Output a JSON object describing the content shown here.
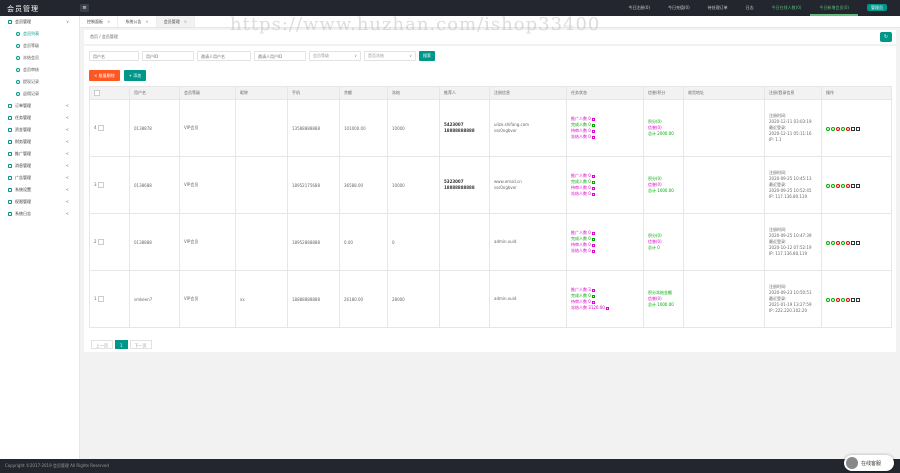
{
  "app": {
    "title": "会员管理"
  },
  "topnav": [
    {
      "label": "今日注册(0)",
      "style": "n"
    },
    {
      "label": "今日充值(0)",
      "style": "n"
    },
    {
      "label": "待处理订单",
      "style": "n"
    },
    {
      "label": "日志",
      "style": "n"
    },
    {
      "label": "今日在线人数(0)",
      "style": "n hl"
    },
    {
      "label": "今日新增会员(0)",
      "style": "n hl act"
    },
    {
      "label": "管理员",
      "style": "n pill"
    }
  ],
  "sidebar": [
    {
      "label": "会员管理",
      "sub": false,
      "chev": "∨"
    },
    {
      "label": "会员列表",
      "sub": true
    },
    {
      "label": "会员等级",
      "sub": true
    },
    {
      "label": "冻结会员",
      "sub": true
    },
    {
      "label": "会员审核",
      "sub": true
    },
    {
      "label": "提现记录",
      "sub": true
    },
    {
      "label": "返佣记录",
      "sub": true
    },
    {
      "label": "订单管理",
      "sub": false,
      "chev": "<"
    },
    {
      "label": "任务管理",
      "sub": false,
      "chev": "<"
    },
    {
      "label": "资金管理",
      "sub": false,
      "chev": "<"
    },
    {
      "label": "财务管理",
      "sub": false,
      "chev": "<"
    },
    {
      "label": "推广管理",
      "sub": false,
      "chev": "<"
    },
    {
      "label": "消息管理",
      "sub": false,
      "chev": "<"
    },
    {
      "label": "广告管理",
      "sub": false,
      "chev": "<"
    },
    {
      "label": "系统设置",
      "sub": false,
      "chev": "<"
    },
    {
      "label": "权限管理",
      "sub": false,
      "chev": "<"
    },
    {
      "label": "系统日志",
      "sub": false,
      "chev": "<"
    }
  ],
  "tabs": [
    {
      "label": "控制面板",
      "close": "×"
    },
    {
      "label": "系统公告",
      "close": "×"
    },
    {
      "label": "会员管理",
      "close": "×"
    }
  ],
  "breadcrumb": "首页 / 会员管理",
  "refresh_icon": "↻",
  "filters": {
    "f1": "用户名",
    "f2": "用户ID",
    "f3": "邀请人用户名",
    "f4": "邀请人用户ID",
    "f5": "会员等级",
    "f6": "是否冻结",
    "search": "搜索"
  },
  "buttons": {
    "delete": "× 批量删除",
    "add": "+ 添加"
  },
  "table": {
    "headers": [
      "",
      "用户名",
      "会员等级",
      "昵称",
      "手机",
      "余额",
      "冻结",
      "推荐人",
      "注册信息",
      "任务状态",
      "信誉/积分",
      "收货地址",
      "注册/登录信息",
      "操作"
    ],
    "rows": [
      {
        "id": "4",
        "username": "0138878",
        "level": "VIP会员",
        "nick": "",
        "phone": "13588888888",
        "balance": "101000.00",
        "frozen": "10000",
        "ref1": "5423007",
        "ref2": "18888888888",
        "reg1": "ulize.shifang.com",
        "reg2": "sss0ngbvor",
        "t1": "推广人数 0",
        "t2": "完成人数 0",
        "t3": "待审人数 0",
        "t4": "冻结人数 0",
        "c1": "积分(0)",
        "c2": "信誉(0)",
        "c3": "总计 2000.00",
        "addr": "",
        "d1": "注册时间:",
        "d2": "2020-12-11 03:03:19",
        "d3": "最近登录:",
        "d4": "2020-12-11 05:11:16",
        "d5": "IP: 1.1"
      },
      {
        "id": "3",
        "username": "0138688",
        "level": "VIP会员",
        "nick": "",
        "phone": "18952175688",
        "balance": "36588.00",
        "frozen": "10000",
        "ref1": "5323007",
        "ref2": "18888888888",
        "reg1": "www.email.cn",
        "reg2": "sss0ngbvor",
        "t1": "推广人数 0",
        "t2": "完成人数 0",
        "t3": "待审人数 0",
        "t4": "冻结人数 0",
        "c1": "积分(0)",
        "c2": "信誉(0)",
        "c3": "总计 1000.00",
        "addr": "",
        "d1": "注册时间:",
        "d2": "2020-09-25 10:45:13",
        "d3": "最近登录:",
        "d4": "2020-09-25 10:52:45",
        "d5": "IP: 117.136.80.119"
      },
      {
        "id": "2",
        "username": "0138888",
        "level": "VIP会员",
        "nick": "",
        "phone": "18952888888",
        "balance": "0.00",
        "frozen": "0",
        "ref1": "",
        "ref2": "",
        "reg1": "admin.xuid",
        "reg2": "",
        "t1": "推广人数 0",
        "t2": "完成人数 0",
        "t3": "待审人数 0",
        "t4": "冻结人数 0",
        "c1": "积分(0)",
        "c2": "信誉(0)",
        "c3": "总计 0",
        "addr": "",
        "d1": "注册时间:",
        "d2": "2020-09-25 10:47:39",
        "d3": "最近登录:",
        "d4": "2020-10-12 07:52:19",
        "d5": "IP: 117.136.80.119"
      },
      {
        "id": "1",
        "username": "smkeen7",
        "level": "VIP会员",
        "nick": "xx",
        "phone": "18888888888",
        "balance": "26180.00",
        "frozen": "28000",
        "ref1": "",
        "ref2": "",
        "reg1": "admin.xuid",
        "reg2": "",
        "t1": "推广人数 3",
        "t2": "完成人数 0",
        "t3": "待审人数 0",
        "t4": "冻结人数 3120.00",
        "c1": "积分冻结金额",
        "c2": "信誉(0)",
        "c3": "总计 1000.00",
        "addr": "",
        "d1": "注册时间:",
        "d2": "2020-09-23 10:50:51",
        "d3": "最近登录:",
        "d4": "2021-01-19 13:27:59",
        "d5": "IP: 222.220.102.20"
      }
    ]
  },
  "pager": {
    "prev": "上一页",
    "page": "1",
    "next": "下一页"
  },
  "footer": "Copyright ©2017-2019 会员管理 All Rights Reserved",
  "service": {
    "label": "在线客服"
  },
  "watermark": "https://www.huzhan.com/ishop33400",
  "colors": {
    "accent": "#009688",
    "danger": "#ff5722",
    "topbar": "#23262e"
  }
}
